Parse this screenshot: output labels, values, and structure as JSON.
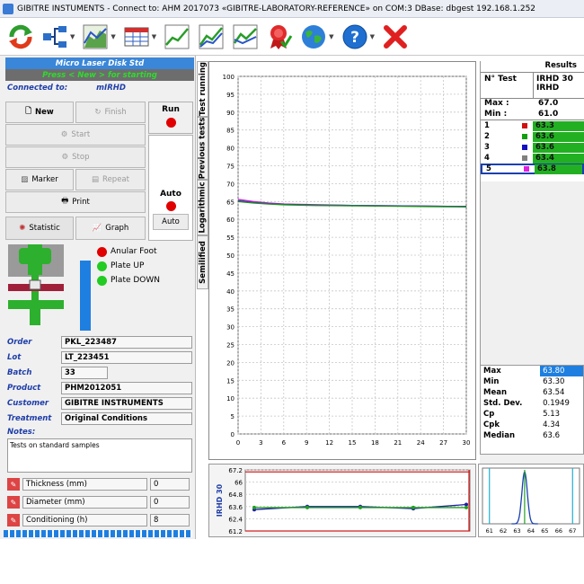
{
  "window": {
    "title": "GIBITRE INSTUMENTS - Connect to: AHM 2017073 «GIBITRE-LABORATORY-REFERENCE» on COM:3     DBase: dbgest  192.168.1.252"
  },
  "toolbar": {
    "icons": [
      "refresh-icon",
      "network-icon",
      "chart-area-icon",
      "table-icon",
      "line-chart-icon",
      "multi-line-chart-icon",
      "compare-chart-icon",
      "certificate-icon",
      "globe-icon",
      "help-icon",
      "close-icon"
    ]
  },
  "left": {
    "instrument": "Micro Laser Disk Std",
    "prompt": "Press < New > for starting",
    "connected_label": "Connected to:",
    "connected_value": "mIRHD",
    "buttons": {
      "new": "New",
      "finish": "Finish",
      "start": "Start",
      "stop": "Stop",
      "marker": "Marker",
      "repeat": "Repeat",
      "print": "Print",
      "statistic": "Statistic",
      "graph": "Graph"
    },
    "run_label": "Run",
    "auto_label": "Auto",
    "auto_button": "Auto",
    "indicators": [
      {
        "label": "Anular Foot",
        "color": "#e00000"
      },
      {
        "label": "Plate UP",
        "color": "#22cc22"
      },
      {
        "label": "Plate DOWN",
        "color": "#22cc22"
      }
    ],
    "fields": [
      {
        "label": "Order",
        "value": "PKL_223487"
      },
      {
        "label": "Lot",
        "value": "LT_223451"
      },
      {
        "label": "Batch",
        "value": "33"
      },
      {
        "label": "Product",
        "value": "PHM2012051"
      },
      {
        "label": "Customer",
        "value": "GIBITRE INSTRUMENTS"
      },
      {
        "label": "Treatment",
        "value": "Original Conditions"
      }
    ],
    "notes_label": "Notes:",
    "notes_value": "Tests on standard samples",
    "measures": [
      {
        "label": "Thickness (mm)",
        "value": "0"
      },
      {
        "label": "Diameter (mm)",
        "value": "0"
      },
      {
        "label": "Conditioning (h)",
        "value": "8"
      }
    ]
  },
  "tabs": [
    "Test running",
    "Previous tests",
    "Logarithmic",
    "Semilified"
  ],
  "chart_data": [
    {
      "type": "line",
      "x_ticks": [
        0,
        3,
        6,
        9,
        12,
        15,
        18,
        21,
        24,
        27,
        30
      ],
      "y_ticks": [
        0,
        5,
        10,
        15,
        20,
        25,
        30,
        35,
        40,
        45,
        50,
        55,
        60,
        65,
        70,
        75,
        80,
        85,
        90,
        95,
        100
      ],
      "xlim": [
        0,
        30
      ],
      "ylim": [
        0,
        100
      ],
      "series": [
        {
          "color": "#d020d0",
          "x": [
            0,
            2,
            4,
            6,
            10,
            15,
            20,
            25,
            30
          ],
          "y": [
            65.6,
            65.0,
            64.6,
            64.3,
            64.1,
            63.9,
            63.8,
            63.7,
            63.6
          ]
        },
        {
          "color": "#3030c0",
          "x": [
            0,
            2,
            4,
            6,
            10,
            15,
            20,
            25,
            30
          ],
          "y": [
            65.2,
            64.7,
            64.4,
            64.2,
            64.0,
            63.9,
            63.8,
            63.7,
            63.6
          ]
        },
        {
          "color": "#209020",
          "x": [
            0,
            2,
            4,
            6,
            10,
            15,
            20,
            25,
            30
          ],
          "y": [
            65.0,
            64.6,
            64.3,
            64.1,
            63.9,
            63.8,
            63.7,
            63.6,
            63.5
          ]
        }
      ]
    },
    {
      "type": "line",
      "ylabel": "IRHD 30",
      "y_ticks": [
        67.2,
        66,
        64.8,
        63.6,
        62.4,
        61.2
      ],
      "ylim": [
        61.2,
        67.2
      ],
      "series": [
        {
          "color": "#2020a0",
          "values": [
            63.3,
            63.6,
            63.6,
            63.4,
            63.8
          ]
        },
        {
          "color": "#20a020",
          "values": [
            63.5,
            63.5,
            63.5,
            63.5,
            63.5
          ]
        }
      ],
      "limits": [
        61.0,
        67.0
      ]
    },
    {
      "type": "area",
      "x_ticks": [
        61,
        62,
        63,
        64,
        65,
        66,
        67
      ],
      "xlim": [
        60.5,
        67.5
      ]
    }
  ],
  "results": {
    "title": "Results",
    "col_test": "N° Test",
    "col_head": [
      "IRHD 30",
      "IRHD"
    ],
    "max_label": "Max :",
    "max_value": "67.0",
    "min_label": "Min :",
    "min_value": "61.0",
    "rows": [
      {
        "n": "1",
        "color": "#d01010",
        "value": "63.3"
      },
      {
        "n": "2",
        "color": "#10a010",
        "value": "63.6"
      },
      {
        "n": "3",
        "color": "#1010c0",
        "value": "63.6"
      },
      {
        "n": "4",
        "color": "#808080",
        "value": "63.4"
      },
      {
        "n": "5",
        "color": "#e020e0",
        "value": "63.8"
      }
    ]
  },
  "stats": [
    {
      "label": "Max",
      "value": "63.80"
    },
    {
      "label": "Min",
      "value": "63.30"
    },
    {
      "label": "Mean",
      "value": "63.54"
    },
    {
      "label": "Std. Dev.",
      "value": "0.1949"
    },
    {
      "label": "Cp",
      "value": "5.13"
    },
    {
      "label": "Cpk",
      "value": "4.34"
    },
    {
      "label": "Median",
      "value": "63.6"
    }
  ]
}
